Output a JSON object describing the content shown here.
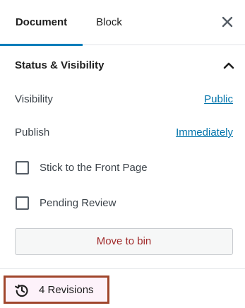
{
  "tabs": {
    "document_label": "Document",
    "block_label": "Block"
  },
  "section": {
    "title": "Status & Visibility"
  },
  "visibility": {
    "label": "Visibility",
    "value": "Public"
  },
  "publish": {
    "label": "Publish",
    "value": "Immediately"
  },
  "options": {
    "stick_to_front": {
      "label": "Stick to the Front Page",
      "checked": false
    },
    "pending_review": {
      "label": "Pending Review",
      "checked": false
    }
  },
  "actions": {
    "move_to_bin_label": "Move to bin"
  },
  "revisions": {
    "label": "4 Revisions"
  },
  "colors": {
    "accent": "#007cba",
    "link": "#0073aa",
    "danger_text": "#a02a2a",
    "highlight_border": "#a0462c",
    "highlight_bg": "#fdf2fa"
  },
  "icons": {
    "close": "close-icon",
    "chevron": "chevron-up-icon",
    "revisions": "history-icon"
  }
}
